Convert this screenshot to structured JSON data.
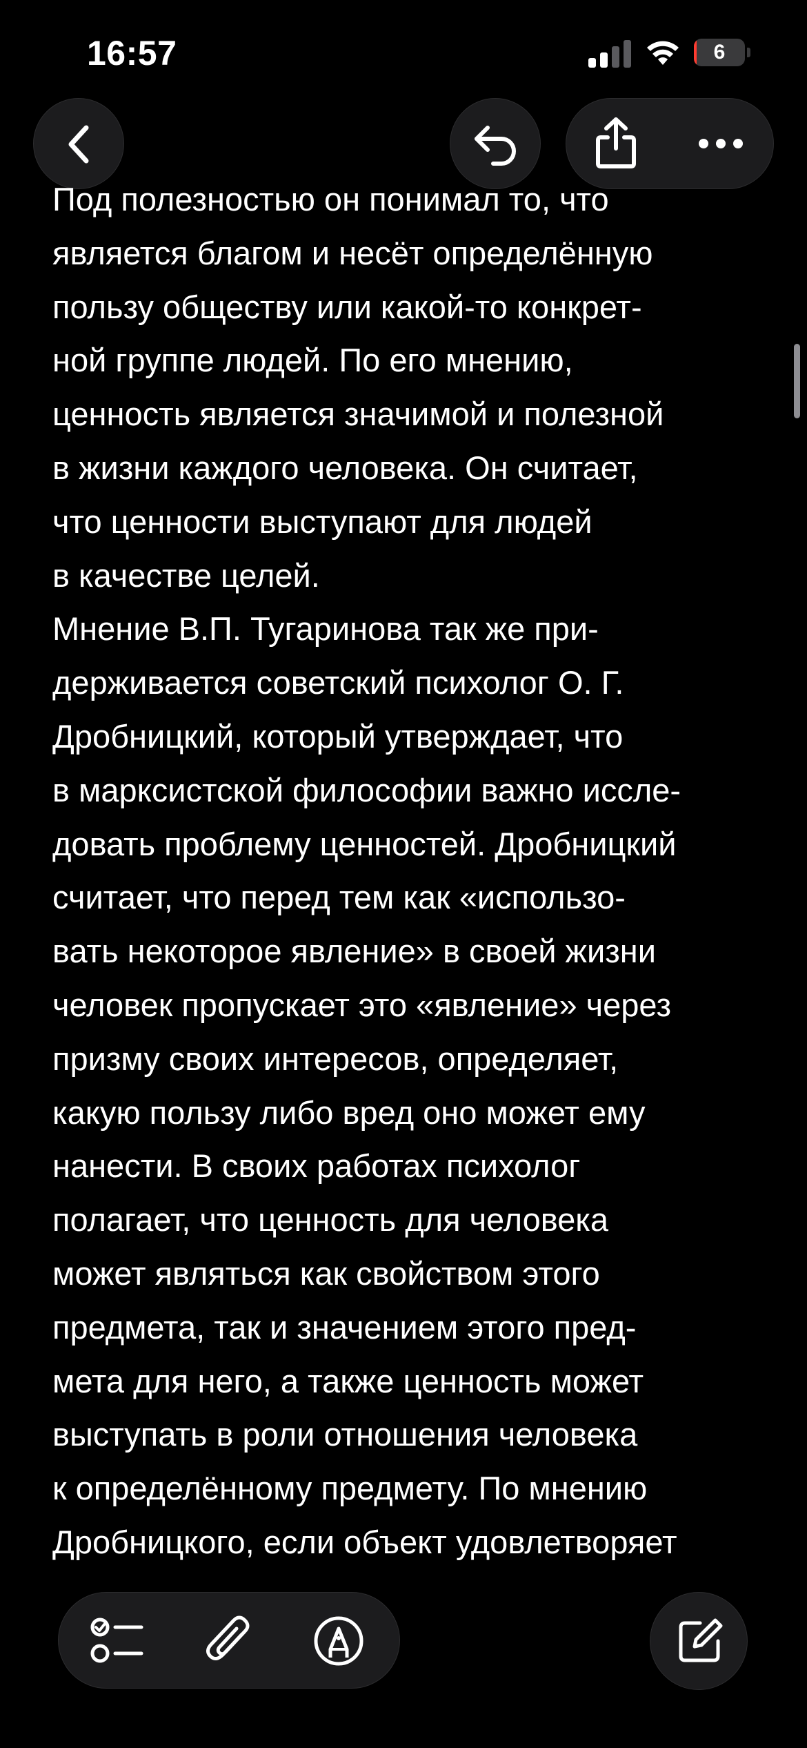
{
  "status_bar": {
    "time": "16:57",
    "battery_level": "6",
    "battery_fraction": 0.06,
    "battery_color": "#ff3b30"
  },
  "toolbar": {
    "back_icon": "chevron-left-icon",
    "undo_icon": "undo-icon",
    "share_icon": "share-icon",
    "more_icon": "ellipsis-icon"
  },
  "note": {
    "lines": [
      "Под полезностью он понимал то, что",
      "является благом и несёт определённую",
      "пользу обществу или какой-то конкрет-",
      "ной группе людей. По его мнению,",
      "ценность является значимой и полезной",
      "в жизни каждого человека. Он считает,",
      "что ценности выступают для людей",
      "в качестве целей.",
      "Мнение В.П. Тугаринова так же при-",
      "держивается советский психолог О. Г.",
      "Дробницкий, который утверждает, что",
      "в марксистской философии важно иссле-",
      "довать проблему ценностей. Дробницкий",
      "считает, что перед тем как «использо-",
      "вать некоторое явление» в своей жизни",
      "человек пропускает это «явление» через",
      "призму своих интересов, определяет,",
      "какую пользу либо вред оно может ему",
      "нанести. В своих работах психолог",
      "полагает, что ценность для человека",
      "может являться как свойством этого",
      "предмета, так и значением этого пред-",
      "мета для него, а также ценность может",
      "выступать в роли отношения человека",
      "к определённому предмету. По мнению",
      "Дробницкого, если объект удовлетворяет"
    ]
  },
  "bottom_toolbar": {
    "checklist_icon": "checklist-icon",
    "attachment_icon": "paperclip-icon",
    "markup_icon": "markup-pen-icon",
    "compose_icon": "compose-icon"
  },
  "colors": {
    "background": "#000000",
    "button_background": "#1c1c1e",
    "text": "#ffffff"
  }
}
